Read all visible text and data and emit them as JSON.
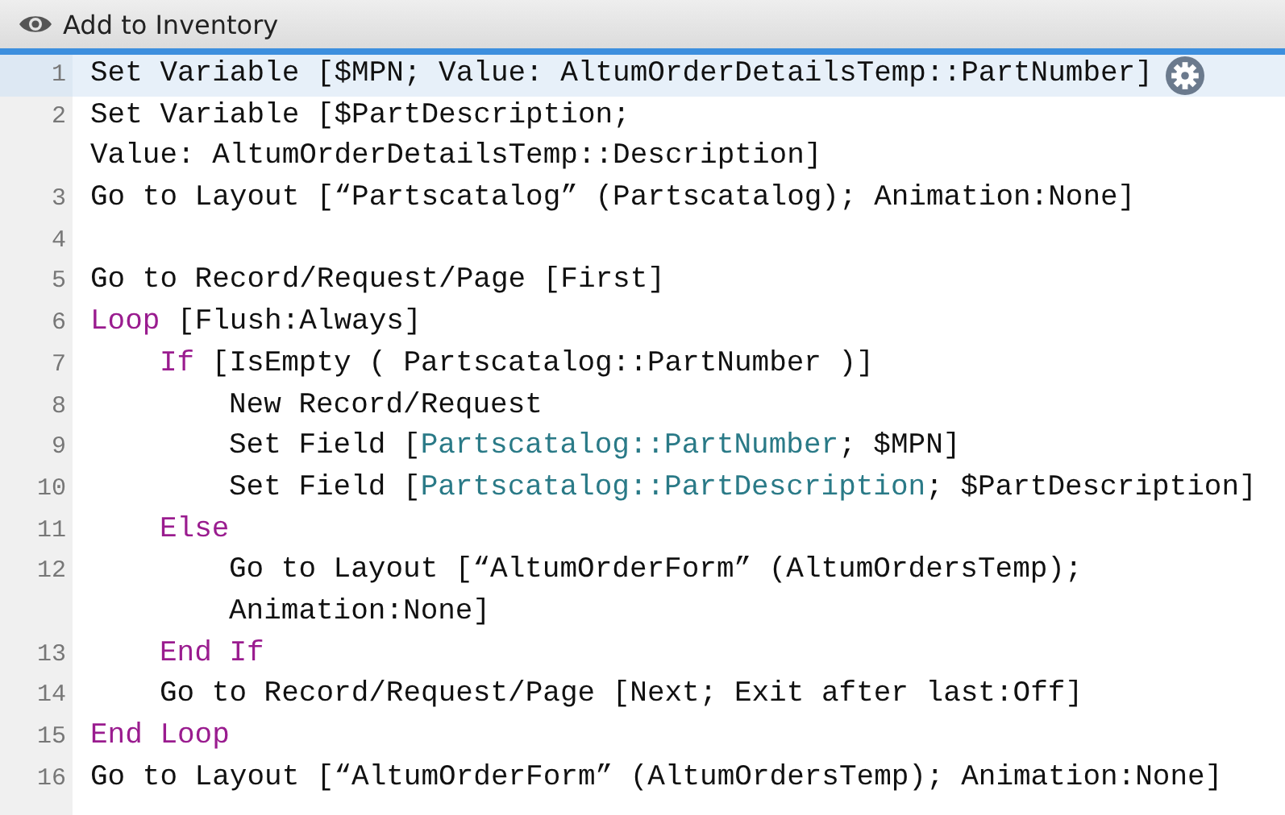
{
  "window": {
    "title": "Add to Inventory"
  },
  "steps": [
    {
      "number": "1",
      "selected": true,
      "lines": [
        [
          {
            "text": "Set Variable [$MPN; Value: AltumOrderDetailsTemp::PartNumber]",
            "kind": "plain"
          }
        ]
      ]
    },
    {
      "number": "2",
      "selected": false,
      "lines": [
        [
          {
            "text": "Set Variable [$PartDescription;",
            "kind": "plain"
          }
        ],
        [
          {
            "text": "Value: AltumOrderDetailsTemp::Description]",
            "kind": "plain"
          }
        ]
      ]
    },
    {
      "number": "3",
      "selected": false,
      "lines": [
        [
          {
            "text": "Go to Layout [“Partscatalog” (Partscatalog); Animation:None]",
            "kind": "plain"
          }
        ]
      ]
    },
    {
      "number": "4",
      "selected": false
    },
    {
      "number": "5",
      "selected": false,
      "lines": [
        [
          {
            "text": "Go to Record/Request/Page [First]",
            "kind": "plain"
          }
        ]
      ]
    },
    {
      "number": "6",
      "selected": false,
      "lines": [
        [
          {
            "text": "Loop",
            "kind": "control"
          },
          {
            "text": " [Flush:Always]",
            "kind": "plain"
          }
        ]
      ],
      "children": [
        {
          "number": "7",
          "selected": false,
          "lines": [
            [
              {
                "text": "If",
                "kind": "control"
              },
              {
                "text": " [IsEmpty ( Partscatalog::PartNumber )]",
                "kind": "plain"
              }
            ]
          ],
          "children": [
            {
              "number": "8",
              "selected": false,
              "lines": [
                [
                  {
                    "text": "New Record/Request",
                    "kind": "plain"
                  }
                ]
              ]
            },
            {
              "number": "9",
              "selected": false,
              "lines": [
                [
                  {
                    "text": "Set Field [",
                    "kind": "plain"
                  },
                  {
                    "text": "Partscatalog::PartNumber",
                    "kind": "field"
                  },
                  {
                    "text": "; $MPN]",
                    "kind": "plain"
                  }
                ]
              ]
            },
            {
              "number": "10",
              "selected": false,
              "lines": [
                [
                  {
                    "text": "Set Field [",
                    "kind": "plain"
                  },
                  {
                    "text": "Partscatalog::PartDescription",
                    "kind": "field"
                  },
                  {
                    "text": "; $PartDescription]",
                    "kind": "plain"
                  }
                ]
              ]
            }
          ]
        },
        {
          "number": "11",
          "selected": false,
          "lines": [
            [
              {
                "text": "Else",
                "kind": "control"
              }
            ]
          ],
          "children": [
            {
              "number": "12",
              "selected": false,
              "lines": [
                [
                  {
                    "text": "Go to Layout [“AltumOrderForm” (AltumOrdersTemp);",
                    "kind": "plain"
                  }
                ],
                [
                  {
                    "text": "Animation:None]",
                    "kind": "plain"
                  }
                ]
              ]
            }
          ]
        },
        {
          "number": "13",
          "selected": false,
          "lines": [
            [
              {
                "text": "End If",
                "kind": "control"
              }
            ]
          ]
        },
        {
          "number": "14",
          "selected": false,
          "lines": [
            [
              {
                "text": "Go to Record/Request/Page [Next; Exit after last:Off]",
                "kind": "plain"
              }
            ]
          ]
        }
      ]
    },
    {
      "number": "15",
      "selected": false,
      "lines": [
        [
          {
            "text": "End Loop",
            "kind": "control"
          }
        ]
      ]
    },
    {
      "number": "16",
      "selected": false,
      "lines": [
        [
          {
            "text": "Go to Layout [“AltumOrderForm” (AltumOrdersTemp); Animation:None]",
            "kind": "plain"
          }
        ]
      ]
    }
  ]
}
